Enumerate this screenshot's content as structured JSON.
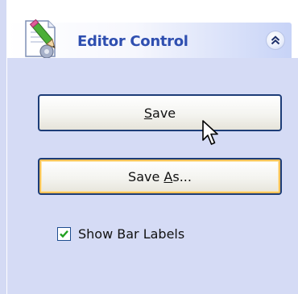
{
  "header": {
    "title": "Editor Control",
    "icon": "editor-pencil-icon",
    "collapse_icon": "chevron-double-up-icon"
  },
  "buttons": {
    "save_prefix": "",
    "save_mnemonic": "S",
    "save_rest": "ave",
    "saveas_prefix": "Save ",
    "saveas_mnemonic": "A",
    "saveas_rest": "s..."
  },
  "options": {
    "show_bar_labels_label": "Show Bar Labels",
    "show_bar_labels_checked": true
  },
  "colors": {
    "title": "#2f4fb0",
    "pane_background": "#d5dbf5",
    "button_border": "#1d3d78",
    "hover_highlight": "#f6c257",
    "check_mark": "#21a121"
  }
}
